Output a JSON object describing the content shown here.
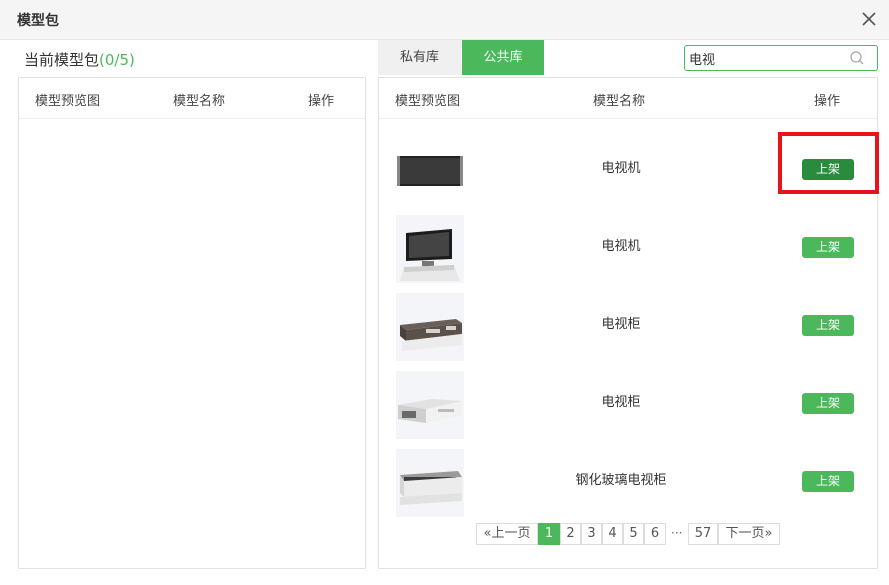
{
  "dialog": {
    "title": "模型包"
  },
  "left": {
    "heading": "当前模型包",
    "count": "(0/5)",
    "columns": [
      "模型预览图",
      "模型名称",
      "操作"
    ]
  },
  "tabs": [
    {
      "label": "私有库",
      "active": false
    },
    {
      "label": "公共库",
      "active": true
    }
  ],
  "search": {
    "value": "电视",
    "icon": "search-icon"
  },
  "right": {
    "columns": [
      "模型预览图",
      "模型名称",
      "操作"
    ],
    "rows": [
      {
        "name": "电视机",
        "action": "上架",
        "thumbnail": "flat-tv-front",
        "active": true
      },
      {
        "name": "电视机",
        "action": "上架",
        "thumbnail": "tv-on-stand",
        "active": false
      },
      {
        "name": "电视柜",
        "action": "上架",
        "thumbnail": "dark-tv-cabinet",
        "active": false
      },
      {
        "name": "电视柜",
        "action": "上架",
        "thumbnail": "white-tv-cabinet",
        "active": false
      },
      {
        "name": "钢化玻璃电视柜",
        "action": "上架",
        "thumbnail": "glass-tv-cabinet",
        "active": false
      }
    ]
  },
  "pagination": {
    "prev": "«上一页",
    "pages": [
      "1",
      "2",
      "3",
      "4",
      "5",
      "6"
    ],
    "current": "1",
    "ellipsis": "···",
    "last": "57",
    "next": "下一页»"
  },
  "colors": {
    "accent": "#4cb85c",
    "active_button": "#2a8a3e",
    "highlight": "#e8141b"
  }
}
